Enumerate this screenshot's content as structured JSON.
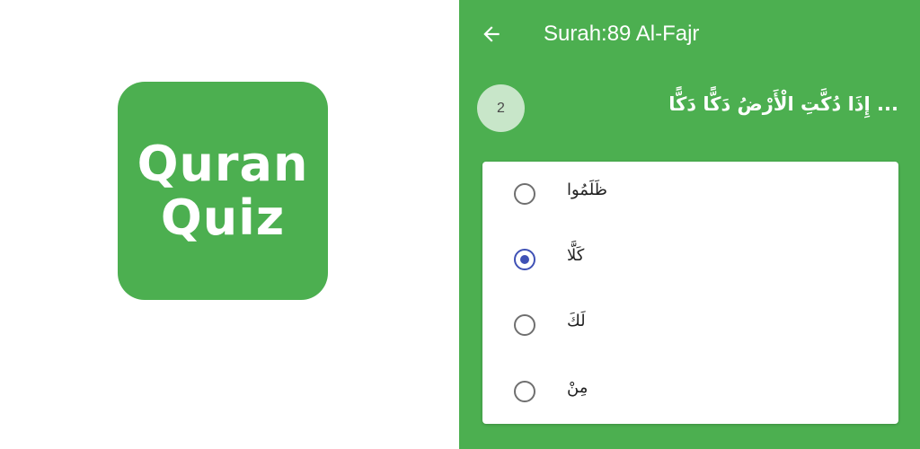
{
  "logo": {
    "line1": "Quran",
    "line2": "Quiz"
  },
  "appbar": {
    "title": "Surah:89 Al-Fajr",
    "back_icon": "arrow-left-icon"
  },
  "question": {
    "number": "2",
    "text": "... إِذَا دُكَّتِ الْأَرْضُ دَكًّا دَكًّا"
  },
  "options": [
    {
      "label": "ظَلَمُوا",
      "selected": false
    },
    {
      "label": "كَلَّا",
      "selected": true
    },
    {
      "label": "لَكَ",
      "selected": false
    },
    {
      "label": "مِنْ",
      "selected": false
    }
  ],
  "colors": {
    "primary": "#4caf50",
    "accent": "#3f51b5",
    "badge": "#c8e6c9"
  }
}
